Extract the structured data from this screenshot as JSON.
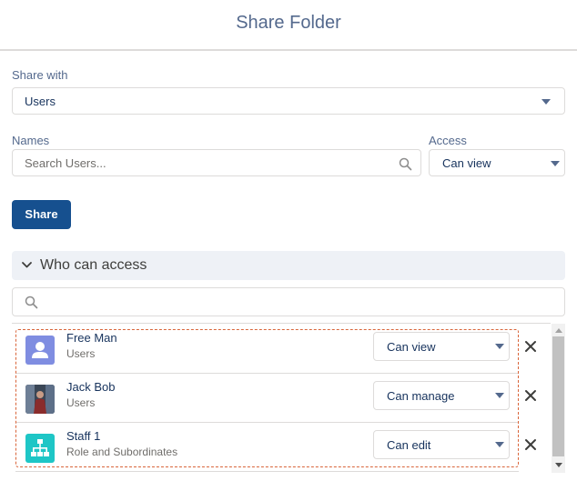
{
  "header": {
    "title": "Share Folder"
  },
  "share_with": {
    "label": "Share with",
    "value": "Users"
  },
  "names": {
    "label": "Names",
    "placeholder": "Search Users..."
  },
  "access": {
    "label": "Access",
    "value": "Can view"
  },
  "share_button": {
    "label": "Share"
  },
  "who_can_access": {
    "title": "Who can access",
    "filter_placeholder": "",
    "entries": [
      {
        "name": "Free Man",
        "type": "Users",
        "access": "Can view",
        "avatar": "user-icon"
      },
      {
        "name": "Jack Bob",
        "type": "Users",
        "access": "Can manage",
        "avatar": "photo"
      },
      {
        "name": "Staff 1",
        "type": "Role and Subordinates",
        "access": "Can edit",
        "avatar": "hierarchy-icon"
      }
    ]
  },
  "colors": {
    "brand": "#16508f",
    "dashed_highlight": "#d9653a",
    "user_avatar_bg": "#7f8de1",
    "role_avatar_bg": "#1ec6c6"
  }
}
